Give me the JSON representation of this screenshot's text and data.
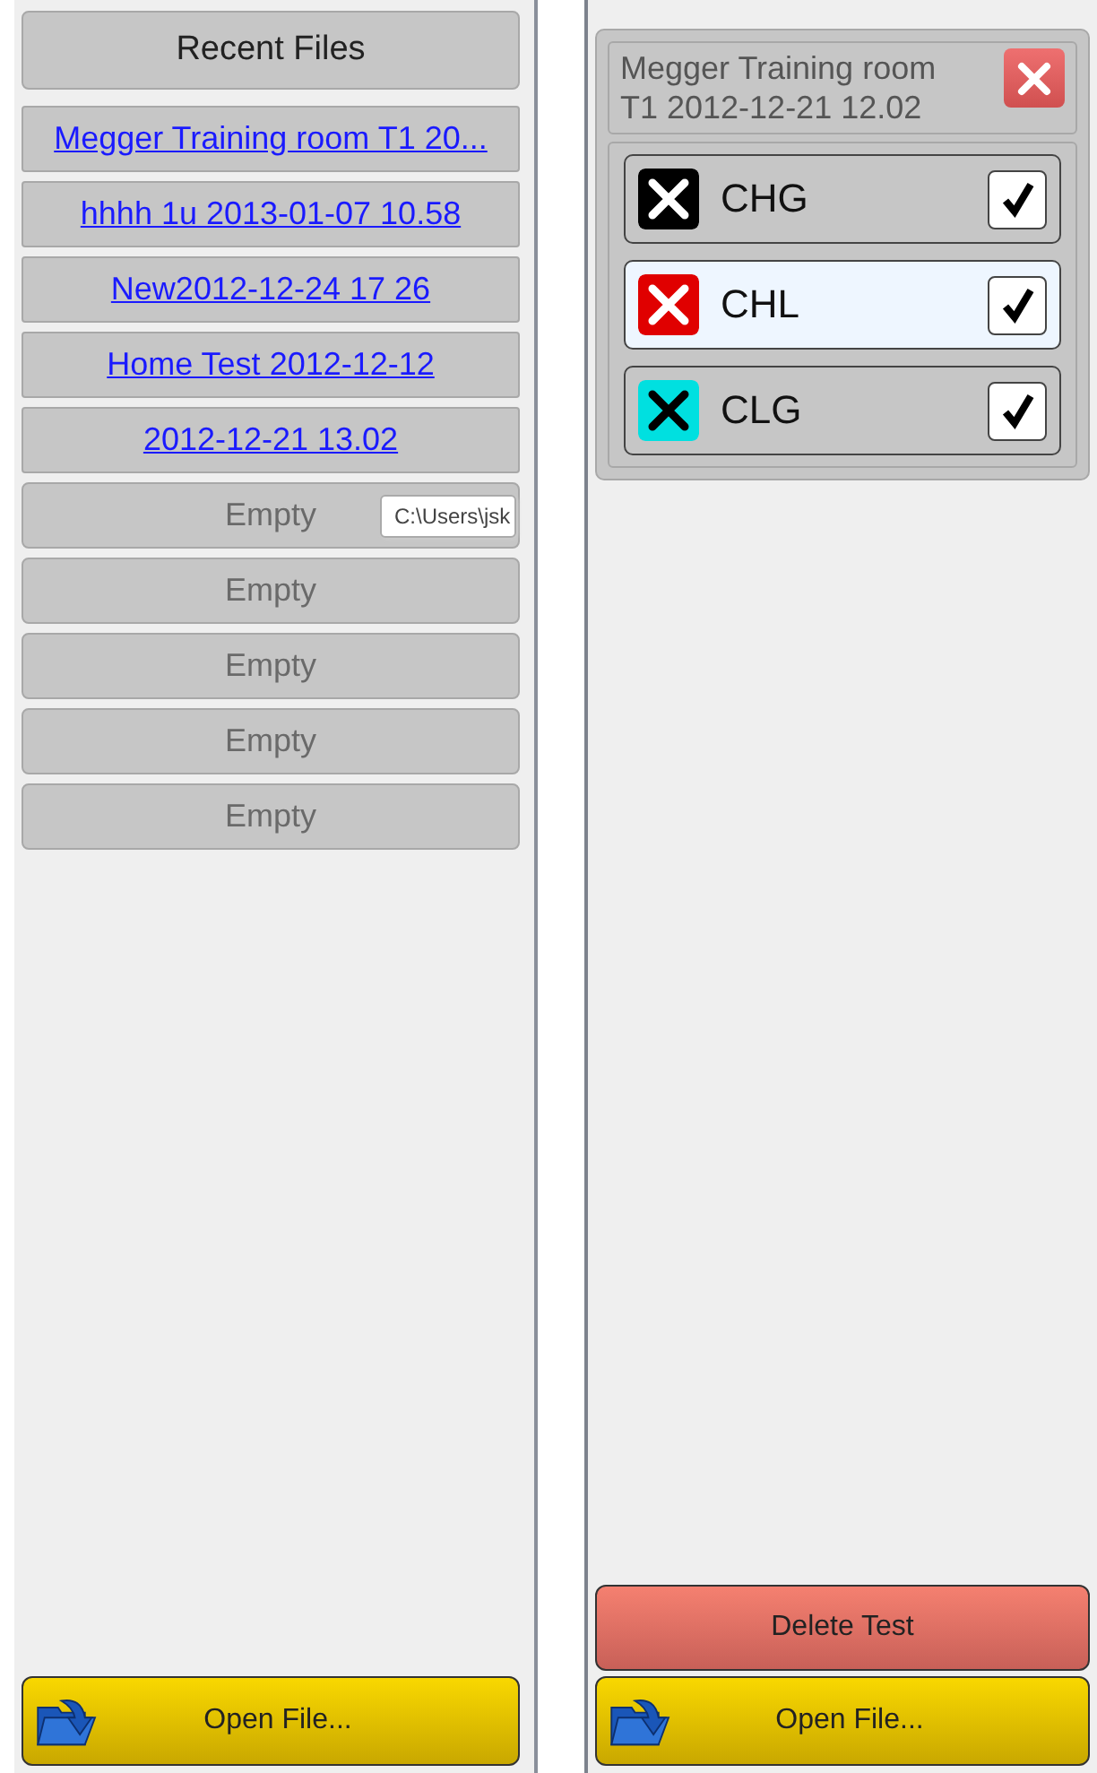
{
  "recent_files": {
    "title": "Recent Files",
    "items": [
      {
        "kind": "file",
        "label": "Megger Training room T1 20..."
      },
      {
        "kind": "file",
        "label": "hhhh 1u 2013-01-07 10.58"
      },
      {
        "kind": "file",
        "label": "New2012-12-24 17 26"
      },
      {
        "kind": "file",
        "label": "Home Test 2012-12-12"
      },
      {
        "kind": "file",
        "label": "2012-12-21 13.02"
      },
      {
        "kind": "empty",
        "label": "Empty"
      },
      {
        "kind": "empty",
        "label": "Empty"
      },
      {
        "kind": "empty",
        "label": "Empty"
      },
      {
        "kind": "empty",
        "label": "Empty"
      },
      {
        "kind": "empty",
        "label": "Empty"
      }
    ],
    "tooltip": {
      "text": "C:\\Users\\jsk"
    },
    "open_button": "Open File..."
  },
  "test_panel": {
    "title": "Megger Training room T1 2012-12-21 12.02",
    "channels": [
      {
        "label": "CHG",
        "color": "#000000",
        "selected": false,
        "checked": true
      },
      {
        "label": "CHL",
        "color": "#e00000",
        "selected": true,
        "checked": true
      },
      {
        "label": "CLG",
        "color": "#00e0e0",
        "selected": false,
        "checked": true
      }
    ],
    "delete_button": "Delete Test",
    "open_button": "Open File..."
  }
}
